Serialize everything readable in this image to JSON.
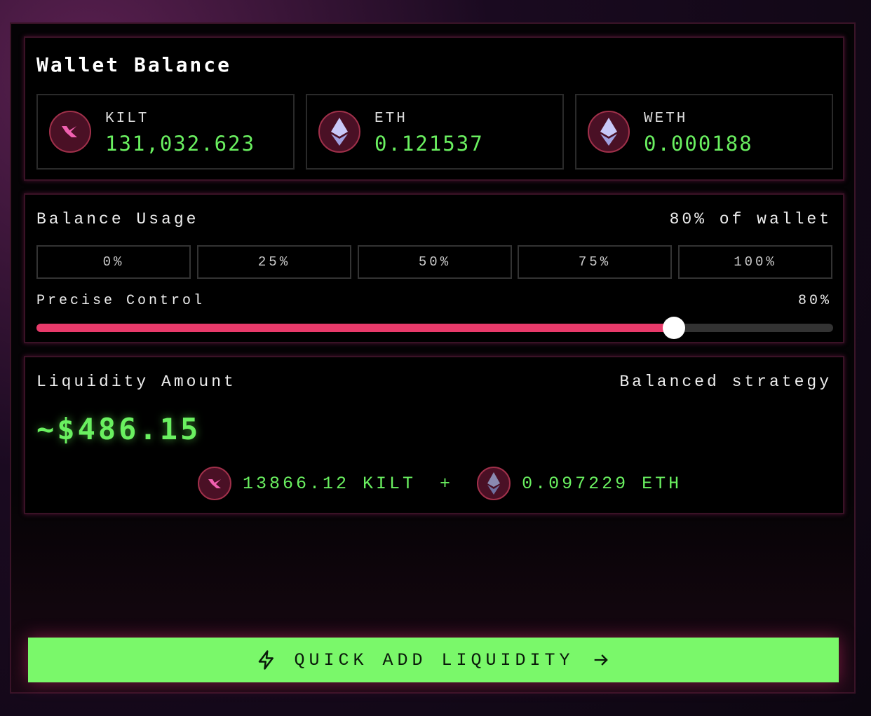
{
  "wallet": {
    "title": "Wallet Balance",
    "tokens": [
      {
        "name": "KILT",
        "value": "131,032.623",
        "icon": "kilt-icon"
      },
      {
        "name": "ETH",
        "value": "0.121537",
        "icon": "eth-icon"
      },
      {
        "name": "WETH",
        "value": "0.000188",
        "icon": "eth-icon"
      }
    ]
  },
  "usage": {
    "title": "Balance Usage",
    "summary": "80% of wallet",
    "presets": [
      "0%",
      "25%",
      "50%",
      "75%",
      "100%"
    ],
    "precise_label": "Precise Control",
    "precise_value": "80%",
    "slider_percent": 80
  },
  "liquidity": {
    "title": "Liquidity Amount",
    "strategy": "Balanced strategy",
    "amount": "~$486.15",
    "kilt_amount": "13866.12 KILT",
    "plus": "+",
    "eth_amount": "0.097229 ETH"
  },
  "cta": {
    "label": "QUICK ADD LIQUIDITY"
  },
  "colors": {
    "accent_green": "#7af86a",
    "accent_pink": "#e83a6a"
  }
}
